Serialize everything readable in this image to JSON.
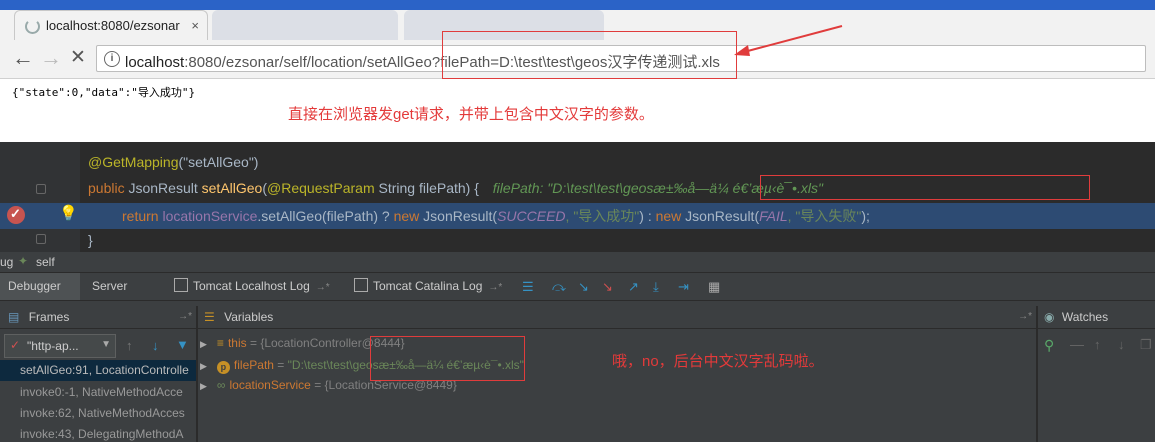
{
  "browser": {
    "tabs": [
      {
        "title": "localhost:8080/ezsonar",
        "close": "×"
      },
      {
        "title": "",
        "close": ""
      },
      {
        "title": "",
        "close": ""
      }
    ],
    "url_host": "localhost",
    "url_rest": ":8080/ezsonar/self/location/setAllGeo?filePath=D:\\test\\test\\geos汉字传递测试.xls",
    "response_json": "{\"state\":0,\"data\":\"导入成功\"}",
    "note": "直接在浏览器发get请求，并带上包含中文汉字的参数。"
  },
  "editor": {
    "line1_annotation": "@GetMapping",
    "line1_arg": "(\"setAllGeo\")",
    "line2": {
      "kw": "public",
      "type": "JsonResult",
      "method": "setAllGeo",
      "params_pre": "(",
      "param_ann": "@RequestParam",
      "params_post": " String filePath) {",
      "inlay_label": "filePath: ",
      "inlay_value": "\"D:\\test\\test\\geosæ±‰å­—ä¼ é€’æµ‹è¯•.xls\""
    },
    "line3": {
      "kw": "return",
      "field": "locationService",
      "call": ".setAllGeo(filePath) ? ",
      "new1": "new",
      "ctor1": " JsonResult(",
      "const1": "SUCCEED",
      "str1": ", \"导入成功\"",
      "mid": ") : ",
      "new2": "new",
      "ctor2": " JsonResult(",
      "const2": "FAIL",
      "str2": ", \"导入失败\"",
      "end": ");"
    },
    "line4": "}"
  },
  "debugger": {
    "title": "self",
    "title_prefix": "ug",
    "tabs": [
      "Debugger",
      "Server",
      "Tomcat Localhost Log",
      "Tomcat Catalina Log"
    ],
    "tab_pin": "→*",
    "frames_title": "Frames",
    "thread_select": "\"http-ap...",
    "frames": [
      "setAllGeo:91, LocationControlle",
      "invoke0:-1, NativeMethodAcce",
      "invoke:62, NativeMethodAcces",
      "invoke:43, DelegatingMethodA"
    ],
    "variables_title": "Variables",
    "variables": [
      {
        "name": "this",
        "eq": " = ",
        "value": "{LocationController@8444}"
      },
      {
        "name": "filePath",
        "eq": " = ",
        "value": "\"D:\\test\\test\\geosæ±‰å­—ä¼ é€’æµ‹è¯•.xls\""
      },
      {
        "name": "locationService",
        "eq": " = ",
        "value": "{LocationService@8449}"
      }
    ],
    "note": "哦，no，后台中文汉字乱码啦。",
    "watches_title": "Watches"
  },
  "colors": {
    "annotation_red": "#e03c3c",
    "ide_bg": "#2b2b2b",
    "panel_bg": "#3c3f41",
    "highlight": "#2d4b73"
  }
}
